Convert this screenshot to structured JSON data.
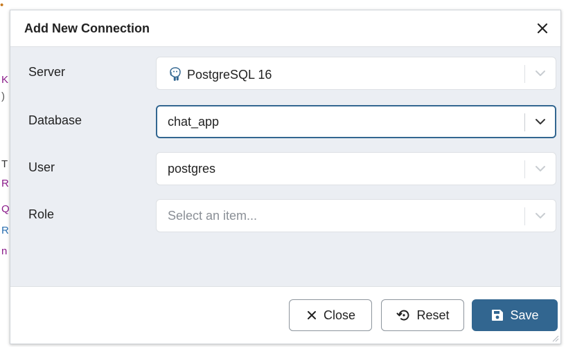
{
  "background": {
    "fragments": [
      "K",
      ")",
      "T",
      "R",
      "Q",
      "R",
      "n"
    ]
  },
  "dialog": {
    "title": "Add New Connection",
    "fields": [
      {
        "label": "Server",
        "value": "PostgreSQL 16",
        "placeholder": "",
        "icon": "postgresql-elephant-icon",
        "focused": false
      },
      {
        "label": "Database",
        "value": "chat_app",
        "placeholder": "",
        "focused": true
      },
      {
        "label": "User",
        "value": "postgres",
        "placeholder": "",
        "focused": false
      },
      {
        "label": "Role",
        "value": "",
        "placeholder": "Select an item...",
        "focused": false
      }
    ],
    "buttons": {
      "close": "Close",
      "reset": "Reset",
      "save": "Save"
    }
  },
  "colors": {
    "primary": "#326690",
    "body_bg": "#ebeef3",
    "border": "#dde0e4",
    "placeholder": "#8a8f96"
  }
}
